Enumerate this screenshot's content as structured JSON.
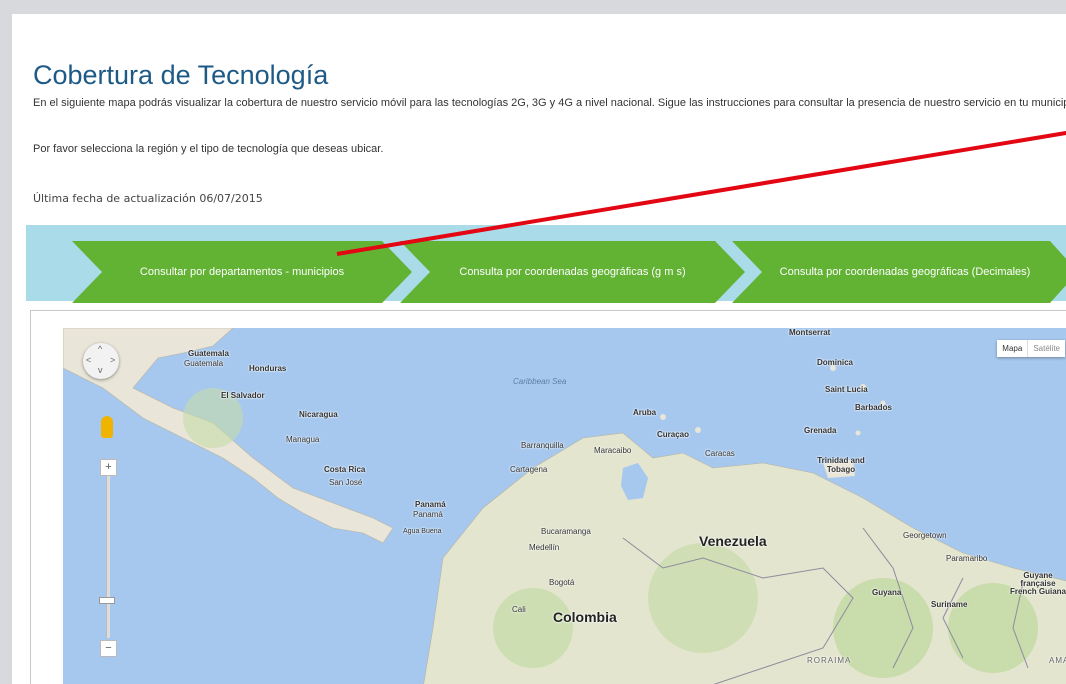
{
  "header": {
    "title": "Cobertura de Tecnología",
    "intro": "En el siguiente mapa podrás visualizar la cobertura de nuestro servicio móvil para las tecnologías 2G, 3G y 4G a nivel nacional. Sigue las instrucciones para consultar la presencia de nuestro servicio en tu municipio",
    "instruction": "Por favor selecciona la región y el tipo de tecnología que deseas ubicar.",
    "updated": "Última fecha de actualización 06/07/2015"
  },
  "steps": [
    {
      "label": "Consultar por departamentos - municipios"
    },
    {
      "label": "Consulta por coordenadas geográficas (g m s)"
    },
    {
      "label": "Consulta por coordenadas geográficas (Decimales)"
    }
  ],
  "colors": {
    "accent": "#62b234",
    "bar": "#a9dbe8",
    "title": "#1e5a86",
    "arrow": "#e30613"
  },
  "map": {
    "maptype": {
      "mapa": "Mapa",
      "satelite": "Satélite"
    },
    "zoom_in": "+",
    "zoom_out": "−",
    "labels": {
      "guatemala_country": "Guatemala",
      "guatemala_city": "Guatemala",
      "honduras": "Honduras",
      "el_salvador": "El Salvador",
      "nicaragua": "Nicaragua",
      "managua": "Managua",
      "costa_rica": "Costa Rica",
      "san_jose": "San José",
      "panama1": "Panamá",
      "panama2": "Panamá",
      "agua_buena": "Agua Buena",
      "caribbean": "Caribbean Sea",
      "montserrat": "Montserrat",
      "dominica": "Dominica",
      "saint_lucia": "Saint Lucia",
      "barbados": "Barbados",
      "grenada": "Grenada",
      "trinidad": "Trinidad and Tobago",
      "aruba": "Aruba",
      "curacao": "Curaçao",
      "barranquilla": "Barranquilla",
      "maracaibo": "Maracaibo",
      "caracas": "Caracas",
      "cartagena": "Cartagena",
      "bucaramanga": "Bucaramanga",
      "venezuela": "Venezuela",
      "georgetown": "Georgetown",
      "paramaribo": "Paramaribo",
      "guyane": "Guyane française French Guiana",
      "guyana": "Guyana",
      "suriname": "Suriname",
      "medellin": "Medellín",
      "bogota": "Bogotá",
      "cali": "Cali",
      "colombia": "Colombia",
      "roraima": "RORAIMA",
      "amapa": "AMAPÁ"
    }
  }
}
